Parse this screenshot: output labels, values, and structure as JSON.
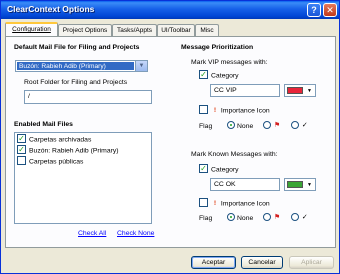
{
  "window": {
    "title": "ClearContext Options"
  },
  "titlebar": {
    "help_glyph": "?",
    "close_glyph": "✕"
  },
  "tabs": [
    "Configuration",
    "Project Options",
    "Tasks/Appts",
    "UI/Toolbar",
    "Misc"
  ],
  "default_mail": {
    "heading": "Default Mail File for Filing and Projects",
    "selected": "Buzón: Rabieh Adib (Primary)",
    "root_label": "Root Folder for Filing and Projects",
    "root_value": "/"
  },
  "enabled_mail": {
    "heading": "Enabled Mail Files",
    "items": [
      {
        "label": "Carpetas archivadas",
        "checked": "✓"
      },
      {
        "label": "Buzón: Rabieh Adib (Primary)",
        "checked": "✓"
      },
      {
        "label": "Carpetas públicas",
        "checked": ""
      }
    ],
    "check_all": "Check All",
    "check_none": "Check None"
  },
  "prioritization": {
    "heading": "Message Prioritization",
    "vip": {
      "label": "Mark VIP messages with:",
      "category_label": "Category",
      "category_checked": "✓",
      "category_value": "CC VIP",
      "color": "#e8253a",
      "importance_label": "Importance Icon",
      "importance_checked": "",
      "flag_label": "Flag",
      "flag_none": "None"
    },
    "known": {
      "label": "Mark Known Messages with:",
      "category_label": "Category",
      "category_checked": "✓",
      "category_value": "CC OK",
      "color": "#3aa535",
      "importance_label": "Importance Icon",
      "importance_checked": "",
      "flag_label": "Flag",
      "flag_none": "None"
    }
  },
  "buttons": {
    "accept": "Aceptar",
    "cancel": "Cancelar",
    "apply": "Aplicar"
  },
  "icons": {
    "importance": "!",
    "flag_red": "⚑",
    "flag_check": "✓",
    "dropdown": "▼"
  }
}
